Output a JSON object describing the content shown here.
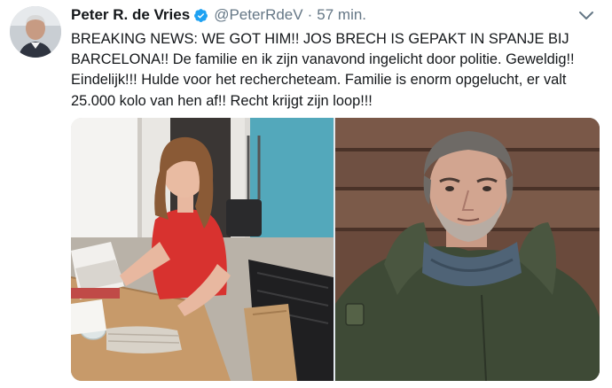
{
  "tweet": {
    "display_name": "Peter R. de Vries",
    "handle": "@PeterRdeV",
    "separator": "·",
    "timestamp": "57 min.",
    "verified": true,
    "avatar_icon": "user-avatar",
    "menu_icon": "chevron-down-icon",
    "text_lines": [
      "BREAKING NEWS: WE GOT HIM!! JOS BRECH IS GEPAKT IN SPANJE BIJ",
      "BARCELONA!! De familie en ik zijn vanavond ingelicht door politie. Geweldig!!",
      "Eindelijk!!! Hulde voor het rechercheteam. Familie is enorm opgelucht, er valt",
      "25.000 kolo van hen af!! Recht krijgt zijn loop!!!"
    ],
    "colors": {
      "text": "#14171a",
      "secondary": "#657786",
      "verified_blue": "#1da1f2"
    }
  }
}
